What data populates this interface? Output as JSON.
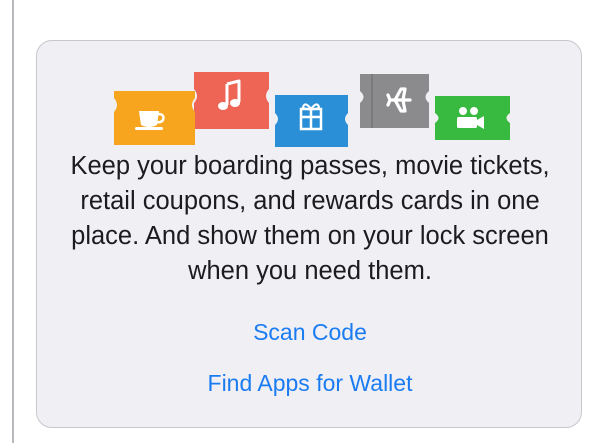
{
  "wallet_card": {
    "icons": [
      {
        "name": "coffee-cup-icon",
        "color": "#f7a51f"
      },
      {
        "name": "music-note-icon",
        "color": "#ee6556"
      },
      {
        "name": "gift-icon",
        "color": "#2a8fd6"
      },
      {
        "name": "airplane-icon",
        "color": "#8b8b8e"
      },
      {
        "name": "movie-camera-icon",
        "color": "#38b93f"
      }
    ],
    "description": "Keep your boarding passes, movie tickets, retail coupons, and rewards cards in one place. And show them on your lock screen when you need them.",
    "scan_code_label": "Scan Code",
    "find_apps_label": "Find Apps for Wallet",
    "link_color": "#1b7cf2"
  }
}
